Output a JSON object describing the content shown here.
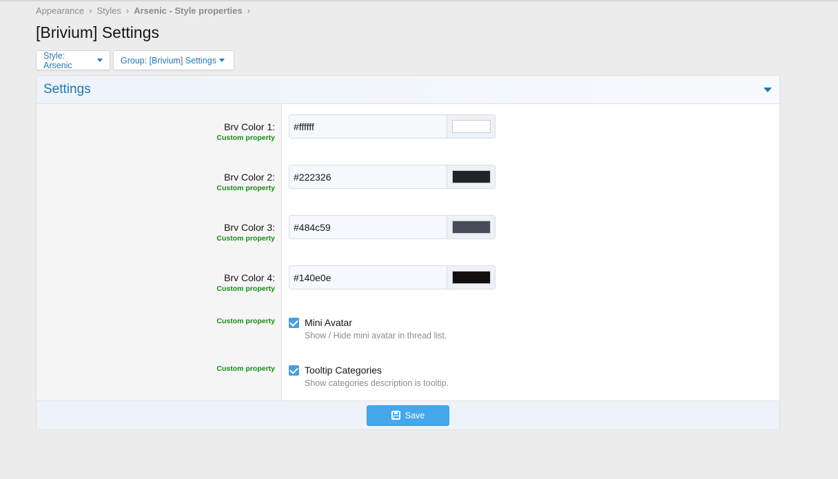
{
  "breadcrumb": {
    "items": [
      "Appearance",
      "Styles",
      "Arsenic - Style properties"
    ],
    "separator": "›"
  },
  "page": {
    "title": "[Brivium] Settings"
  },
  "filters": {
    "style_label": "Style: Arsenic",
    "group_label": "Group: [Brivium] Settings"
  },
  "panel": {
    "title": "Settings",
    "custom_label": "Custom property",
    "colors": [
      {
        "label": "Brv Color 1:",
        "value": "#ffffff",
        "swatch": "#ffffff"
      },
      {
        "label": "Brv Color 2:",
        "value": "#222326",
        "swatch": "#222326"
      },
      {
        "label": "Brv Color 3:",
        "value": "#484c59",
        "swatch": "#484c59"
      },
      {
        "label": "Brv Color 4:",
        "value": "#140e0e",
        "swatch": "#140e0e"
      }
    ],
    "toggles": [
      {
        "title": "Mini Avatar",
        "description": "Show / Hide mini avatar in thread list.",
        "checked": true
      },
      {
        "title": "Tooltip Categories",
        "description": "Show categories description is tooltip.",
        "checked": true
      }
    ]
  },
  "footer": {
    "save_label": "Save"
  },
  "colors": {
    "accent": "#2577b1",
    "button": "#47a7eb",
    "custom_property": "#1a8a1a"
  }
}
